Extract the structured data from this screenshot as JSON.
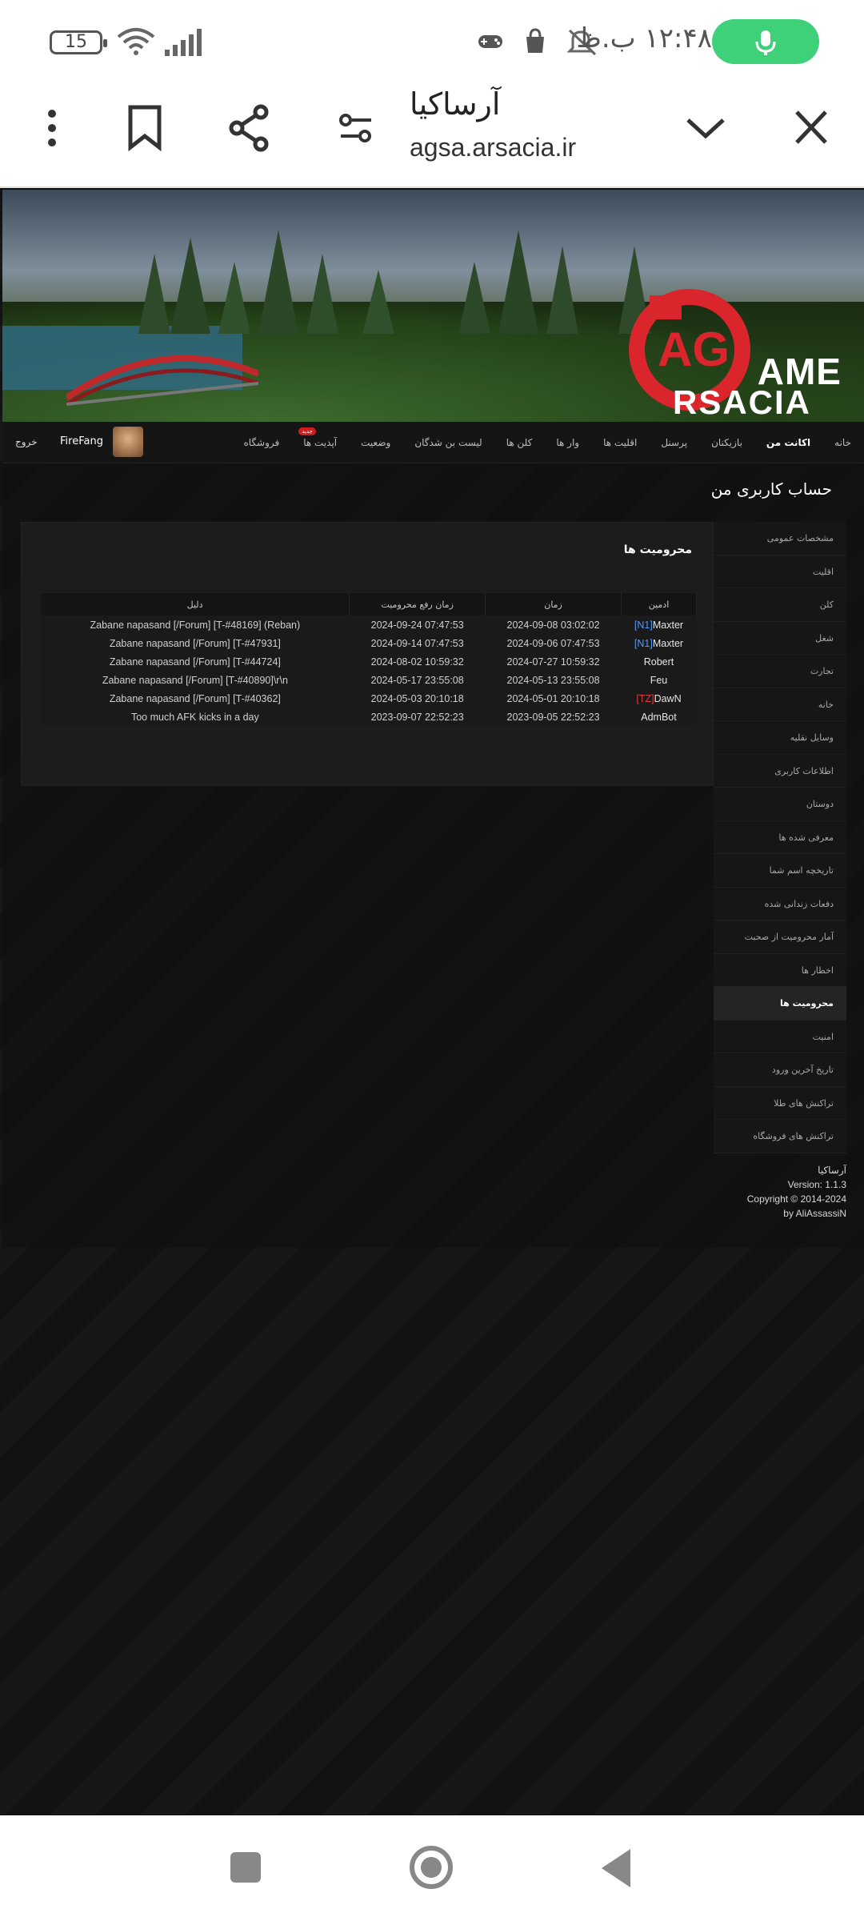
{
  "status_bar": {
    "battery": "15",
    "time": "۱۲:۴۸ ب.ظ"
  },
  "browser": {
    "title": "آرساکیا",
    "url": "agsa.arsacia.ir"
  },
  "banner": {
    "logo_line1": "AME",
    "logo_line2": "RSACIA",
    "logo_letters": "AG"
  },
  "nav": {
    "items": [
      {
        "label": "خانه",
        "active": false
      },
      {
        "label": "اکانت من",
        "active": true
      },
      {
        "label": "بازیکنان",
        "active": false
      },
      {
        "label": "پرسنل",
        "active": false
      },
      {
        "label": "اقلیت ها",
        "active": false
      },
      {
        "label": "وار ها",
        "active": false
      },
      {
        "label": "کلن ها",
        "active": false
      },
      {
        "label": "لیست بن شدگان",
        "active": false
      },
      {
        "label": "وضعیت",
        "active": false
      },
      {
        "label": "آپدیت ها",
        "active": false
      },
      {
        "label": "فروشگاه",
        "active": false
      }
    ],
    "badge": "جدید",
    "user_name": "FireFang",
    "logout_label": "خروج"
  },
  "page": {
    "heading": "حساب کاربری من"
  },
  "sidebar": {
    "items": [
      {
        "label": "مشخصات عمومی",
        "active": false
      },
      {
        "label": "اقلیت",
        "active": false
      },
      {
        "label": "کلن",
        "active": false
      },
      {
        "label": "شغل",
        "active": false
      },
      {
        "label": "تجارت",
        "active": false
      },
      {
        "label": "خانه",
        "active": false
      },
      {
        "label": "وسایل نقلیه",
        "active": false
      },
      {
        "label": "اطلاعات کاربری",
        "active": false
      },
      {
        "label": "دوستان",
        "active": false
      },
      {
        "label": "معرفی شده ها",
        "active": false
      },
      {
        "label": "تاریخچه اسم شما",
        "active": false
      },
      {
        "label": "دفعات زندانی شده",
        "active": false
      },
      {
        "label": "آمار محرومیت از صحبت",
        "active": false
      },
      {
        "label": "اخطار ها",
        "active": false
      },
      {
        "label": "محرومیت ها",
        "active": true
      },
      {
        "label": "امنیت",
        "active": false
      },
      {
        "label": "تاریخ آخرین ورود",
        "active": false
      },
      {
        "label": "تراکنش های طلا",
        "active": false
      },
      {
        "label": "تراکنش های فروشگاه",
        "active": false
      }
    ]
  },
  "bans_panel": {
    "title": "محرومیت ها",
    "columns": {
      "reason": "دلیل",
      "unban_time": "زمان رفع محرومیت",
      "time": "زمان",
      "admin": "ادمین"
    },
    "rows": [
      {
        "reason": "Zabane napasand [/Forum] [T-#48169] (Reban)",
        "unban_time": "2024-09-24 07:47:53",
        "time": "2024-09-08 03:02:02",
        "admin_tag": "[N1]",
        "admin_tag_color": "#4d9cff",
        "admin": "Maxter"
      },
      {
        "reason": "Zabane napasand [/Forum] [T-#47931]",
        "unban_time": "2024-09-14 07:47:53",
        "time": "2024-09-06 07:47:53",
        "admin_tag": "[N1]",
        "admin_tag_color": "#4d9cff",
        "admin": "Maxter"
      },
      {
        "reason": "Zabane napasand [/Forum] [T-#44724]",
        "unban_time": "2024-08-02 10:59:32",
        "time": "2024-07-27 10:59:32",
        "admin_tag": "",
        "admin_tag_color": "",
        "admin": "Robert"
      },
      {
        "reason": "Zabane napasand [/Forum] [T-#40890]\\r\\n",
        "unban_time": "2024-05-17 23:55:08",
        "time": "2024-05-13 23:55:08",
        "admin_tag": "",
        "admin_tag_color": "",
        "admin": "Feu"
      },
      {
        "reason": "Zabane napasand [/Forum] [T-#40362]",
        "unban_time": "2024-05-03 20:10:18",
        "time": "2024-05-01 20:10:18",
        "admin_tag": "[TZ]",
        "admin_tag_color": "#e03a3a",
        "admin": "DawN"
      },
      {
        "reason": "Too much AFK kicks in a day",
        "unban_time": "2023-09-07 22:52:23",
        "time": "2023-09-05 22:52:23",
        "admin_tag": "",
        "admin_tag_color": "",
        "admin": "AdmBot"
      }
    ]
  },
  "footer": {
    "site": "آرساکیا",
    "version": "Version: 1.1.3",
    "copyright": "Copyright © 2014-2024",
    "author": "by AliAssassiN"
  }
}
